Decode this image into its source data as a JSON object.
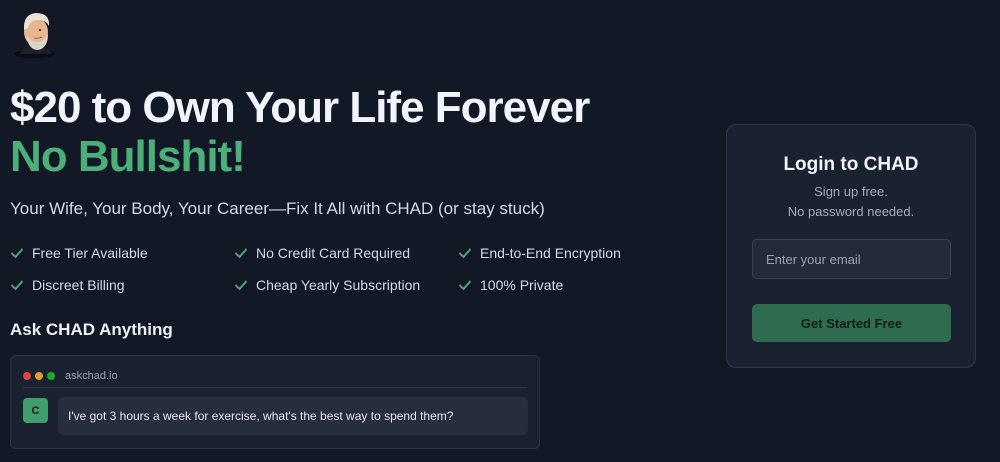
{
  "avatar": {
    "icon": "bearded-man-avatar"
  },
  "hero": {
    "title": "$20 to Own Your Life Forever",
    "subtitle": "No Bullshit!",
    "tagline": "Your Wife, Your Body, Your Career—Fix It All with CHAD (or stay stuck)"
  },
  "features": [
    {
      "label": "Free Tier Available",
      "icon": "check-icon"
    },
    {
      "label": "No Credit Card Required",
      "icon": "check-icon"
    },
    {
      "label": "End-to-End Encryption",
      "icon": "check-icon"
    },
    {
      "label": "Discreet Billing",
      "icon": "check-icon"
    },
    {
      "label": "Cheap Yearly Subscription",
      "icon": "check-icon"
    },
    {
      "label": "100% Private",
      "icon": "check-icon"
    }
  ],
  "ask": {
    "heading": "Ask CHAD Anything",
    "window_url": "askchad.io",
    "avatar_letter": "C",
    "message": "I've got 3 hours a week for exercise, what's the best way to spend them?"
  },
  "login": {
    "title": "Login to CHAD",
    "line1": "Sign up free.",
    "line2": "No password needed.",
    "email_placeholder": "Enter your email",
    "email_value": "",
    "button_label": "Get Started Free"
  },
  "colors": {
    "background": "#121826",
    "accent_green": "#4caf7a",
    "button_green": "#2f6b4f",
    "card": "#1a2130"
  }
}
